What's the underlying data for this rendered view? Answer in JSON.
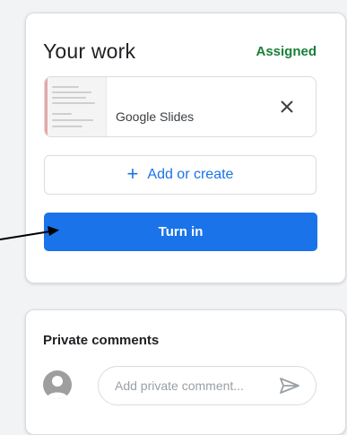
{
  "your_work": {
    "title": "Your work",
    "status": "Assigned",
    "status_color": "#188038",
    "attachment": {
      "label": "Google Slides",
      "remove_icon": "close-icon"
    },
    "add_button": {
      "icon": "plus-icon",
      "label": "Add or create"
    },
    "turn_in_label": "Turn in",
    "accent_color": "#1a73e8"
  },
  "private_comments": {
    "title": "Private comments",
    "placeholder": "Add private comment...",
    "send_icon": "send-icon"
  }
}
